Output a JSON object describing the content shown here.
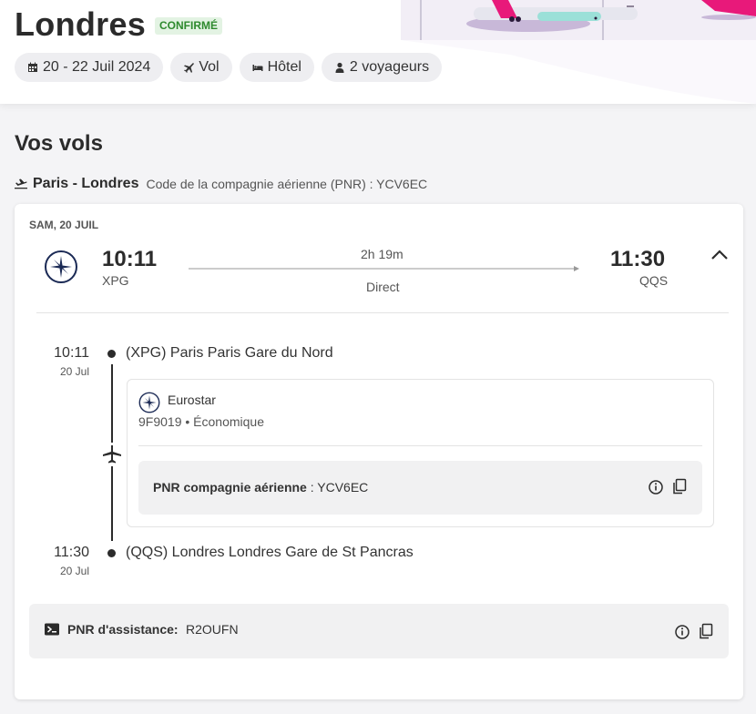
{
  "trip": {
    "title": "Londres",
    "status": "CONFIRMÉ",
    "chips": {
      "dates": "20 - 22 Juil 2024",
      "flight": "Vol",
      "hotel": "Hôtel",
      "travelers": "2 voyageurs"
    }
  },
  "section_title": "Vos vols",
  "route": {
    "name": "Paris - Londres",
    "pnr_text": "Code de la compagnie aérienne (PNR) : YCV6EC"
  },
  "flight": {
    "date_label": "SAM, 20 JUIL",
    "departure_time": "10:11",
    "departure_code": "XPG",
    "duration": "2h 19m",
    "stops": "Direct",
    "arrival_time": "11:30",
    "arrival_code": "QQS"
  },
  "timeline": {
    "origin": {
      "time": "10:11",
      "date": "20 Jul",
      "station": "(XPG) Paris Paris Gare du Nord"
    },
    "destination": {
      "time": "11:30",
      "date": "20 Jul",
      "station": "(QQS) Londres Londres Gare de St Pancras"
    }
  },
  "segment": {
    "carrier": "Eurostar",
    "details": "9F9019 • Économique",
    "pnr_label": "PNR compagnie aérienne",
    "pnr_sep": " : ",
    "pnr_value": "YCV6EC"
  },
  "assistance": {
    "label": "PNR d'assistance:",
    "value": "R2OUFN"
  },
  "colors": {
    "accent_pink": "#e8197a",
    "logo_navy": "#1b2a55",
    "status_green": "#2e8a2e"
  }
}
